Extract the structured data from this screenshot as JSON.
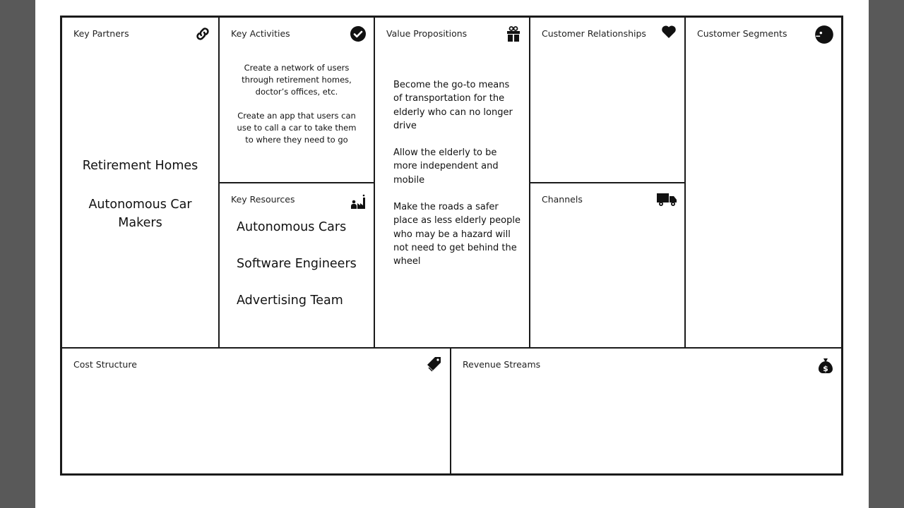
{
  "canvas": {
    "key_partners": {
      "title": "Key Partners",
      "icon": "link-icon",
      "items": [
        "Retirement Homes",
        "Autonomous Car Makers"
      ]
    },
    "key_activities": {
      "title": "Key Activities",
      "icon": "check-circle-icon",
      "items": [
        "Create a network of users through retirement homes, doctor’s offices, etc.",
        "Create an app that users can use to call a car to take them to where they need to go"
      ]
    },
    "key_resources": {
      "title": "Key Resources",
      "icon": "factory-worker-icon",
      "items": [
        "Autonomous Cars",
        "Software Engineers",
        "Advertising Team"
      ]
    },
    "value_propositions": {
      "title": "Value Propositions",
      "icon": "gift-icon",
      "items": [
        "Become the go-to means of transportation for the elderly who can no longer drive",
        "Allow the elderly to be more independent and mobile",
        "Make the roads a safer place as less elderly people who may be a hazard will not need to get behind the wheel"
      ]
    },
    "customer_relationships": {
      "title": "Customer Relationships",
      "icon": "heart-icon"
    },
    "channels": {
      "title": "Channels",
      "icon": "truck-icon"
    },
    "customer_segments": {
      "title": "Customer Segments",
      "icon": "face-icon"
    },
    "cost_structure": {
      "title": "Cost Structure",
      "icon": "price-tag-icon"
    },
    "revenue_streams": {
      "title": "Revenue Streams",
      "icon": "money-bag-icon"
    }
  }
}
